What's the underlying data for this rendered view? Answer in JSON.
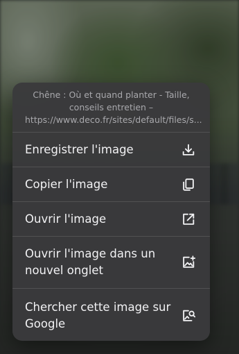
{
  "header": {
    "text": "Chêne : Où et quand planter - Taille, conseils entretien – https://www.deco.fr/sites/default/files/s..."
  },
  "menu": {
    "items": [
      {
        "label": "Enregistrer l'image",
        "icon": "download-icon"
      },
      {
        "label": "Copier l'image",
        "icon": "copy-icon"
      },
      {
        "label": "Ouvrir l'image",
        "icon": "open-external-icon"
      },
      {
        "label": "Ouvrir l'image dans un nouvel onglet",
        "icon": "image-add-icon"
      },
      {
        "label": "Chercher cette image sur Google",
        "icon": "image-search-icon"
      }
    ]
  },
  "colors": {
    "menu_background": "#3a3a3c",
    "text": "#f2f2f4",
    "header_text": "#a9a9ad"
  }
}
